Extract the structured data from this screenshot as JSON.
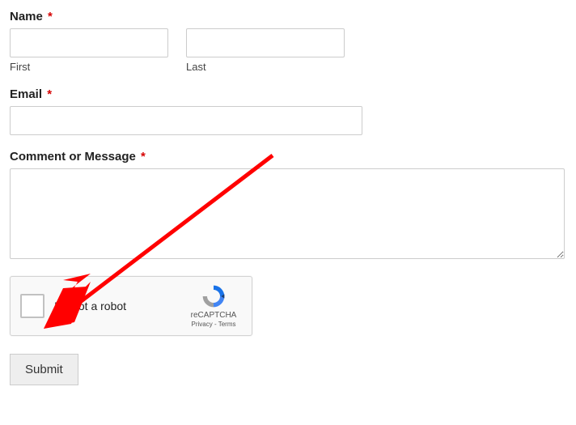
{
  "form": {
    "name": {
      "label": "Name",
      "required_marker": "*",
      "first_sublabel": "First",
      "last_sublabel": "Last",
      "first_value": "",
      "last_value": ""
    },
    "email": {
      "label": "Email",
      "required_marker": "*",
      "value": ""
    },
    "message": {
      "label": "Comment or Message",
      "required_marker": "*",
      "value": ""
    },
    "recaptcha": {
      "checkbox_label": "I'm not a robot",
      "brand": "reCAPTCHA",
      "privacy": "Privacy",
      "separator": " - ",
      "terms": "Terms"
    },
    "submit_label": "Submit",
    "annotation": {
      "arrow_color": "#ff0000",
      "arrow_description": "red-arrow-pointing-to-recaptcha-checkbox"
    }
  }
}
